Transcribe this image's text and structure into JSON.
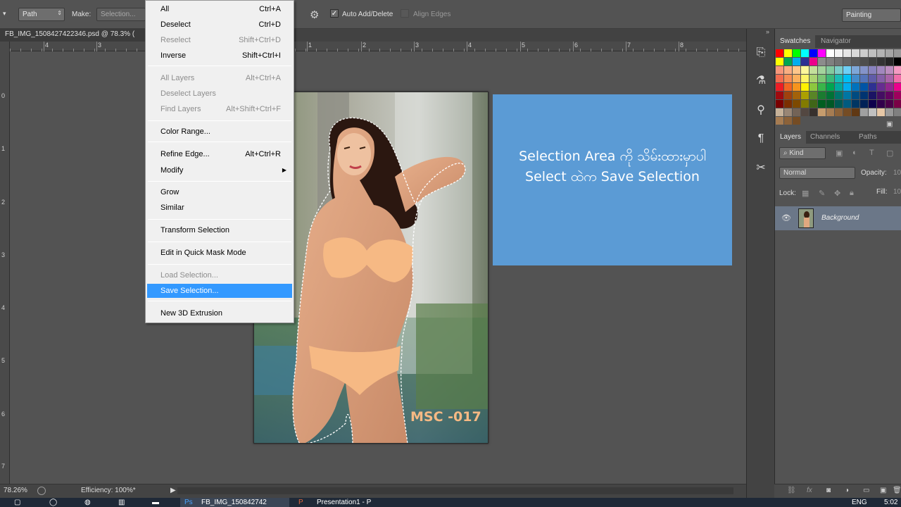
{
  "options_bar": {
    "path_select": "Path",
    "make_label": "Make:",
    "selection_button": "Selection...",
    "auto_add_delete": "Auto Add/Delete",
    "align_edges": "Align Edges",
    "workspace": "Painting"
  },
  "document": {
    "tab_title": "FB_IMG_1508427422346.psd @ 78.3% (",
    "hruler_labels": [
      "4",
      "3",
      "1",
      "2",
      "3",
      "4",
      "5",
      "6",
      "7",
      "8"
    ],
    "vruler_labels": [
      "0",
      "1",
      "2",
      "3",
      "4",
      "5",
      "6",
      "7"
    ],
    "watermark": "MSC -017",
    "note_line1": "Selection Area ကို သိမ်းထားမှာပါ",
    "note_line2": "Select ထဲက Save Selection"
  },
  "menu": {
    "items": [
      {
        "label": "All",
        "shortcut": "Ctrl+A"
      },
      {
        "label": "Deselect",
        "shortcut": "Ctrl+D"
      },
      {
        "label": "Reselect",
        "shortcut": "Shift+Ctrl+D"
      },
      {
        "label": "Inverse",
        "shortcut": "Shift+Ctrl+I"
      },
      {
        "label": "All Layers",
        "shortcut": "Alt+Ctrl+A"
      },
      {
        "label": "Deselect Layers",
        "shortcut": ""
      },
      {
        "label": "Find Layers",
        "shortcut": "Alt+Shift+Ctrl+F"
      },
      {
        "label": "Color Range...",
        "shortcut": ""
      },
      {
        "label": "Refine Edge...",
        "shortcut": "Alt+Ctrl+R"
      },
      {
        "label": "Modify",
        "shortcut": ""
      },
      {
        "label": "Grow",
        "shortcut": ""
      },
      {
        "label": "Similar",
        "shortcut": ""
      },
      {
        "label": "Transform Selection",
        "shortcut": ""
      },
      {
        "label": "Edit in Quick Mask Mode",
        "shortcut": ""
      },
      {
        "label": "Load Selection...",
        "shortcut": ""
      },
      {
        "label": "Save Selection...",
        "shortcut": ""
      },
      {
        "label": "New 3D Extrusion",
        "shortcut": ""
      }
    ],
    "highlight_color": "#3399ff"
  },
  "panels": {
    "swatches_tabs": [
      "Swatches",
      "Navigator"
    ],
    "layers_tabs": [
      "Layers",
      "Channels",
      "Paths"
    ],
    "kind_filter": "Kind",
    "blend_mode": "Normal",
    "opacity_label": "Opacity:",
    "opacity_value": "10",
    "lock_label": "Lock:",
    "fill_label": "Fill:",
    "fill_value": "10",
    "layer_name": "Background"
  },
  "status": {
    "zoom": "78.26%",
    "efficiency": "Efficiency: 100%*"
  },
  "taskbar": {
    "lang": "ENG",
    "time": "5:02",
    "ps_task": "FB_IMG_150842742",
    "ppt_task": "Presentation1 - P"
  }
}
